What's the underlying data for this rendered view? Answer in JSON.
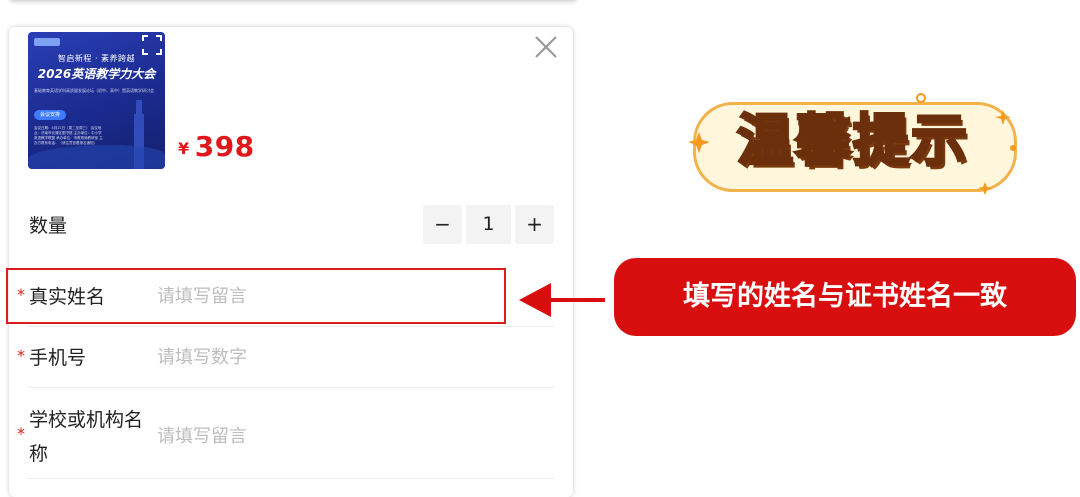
{
  "product": {
    "poster": {
      "line1": "智启新程 · 素养跨越",
      "line2": "2026英语教学力大会",
      "small": "基础教育英语学科高质量发展论坛（初中、高中）暨英语教学研讨会",
      "badge": "会议安排",
      "details": "会议日期：4月21日（周二至周三） 会议地点：济南市长清区图书馆 主办单位：中小学英语教学联盟 承办单位：市教育局教研室 主办方联系电话：（请注意查看报名通知）"
    },
    "price": {
      "currency": "¥",
      "amount": "398"
    }
  },
  "form": {
    "quantity": {
      "label": "数量",
      "minus": "−",
      "value": "1",
      "plus": "+"
    },
    "fields": [
      {
        "label": "真实姓名",
        "placeholder": "请填写留言",
        "required": "*"
      },
      {
        "label": "手机号",
        "placeholder": "请填写数字",
        "required": "*"
      },
      {
        "label_line1": "学校或机构名",
        "label_line2": "称",
        "placeholder": "请填写留言",
        "required": "*"
      }
    ]
  },
  "callout": {
    "text": "填写的姓名与证书姓名一致"
  },
  "badge": {
    "text": "温馨提示"
  },
  "colors": {
    "accent_red": "#d90f0f",
    "price_red": "#e0171b",
    "badge_orange": "#f59a1d"
  },
  "icons": {
    "close": "close-icon",
    "fullscreen": "fullscreen-icon",
    "arrow": "arrow-left-icon"
  }
}
